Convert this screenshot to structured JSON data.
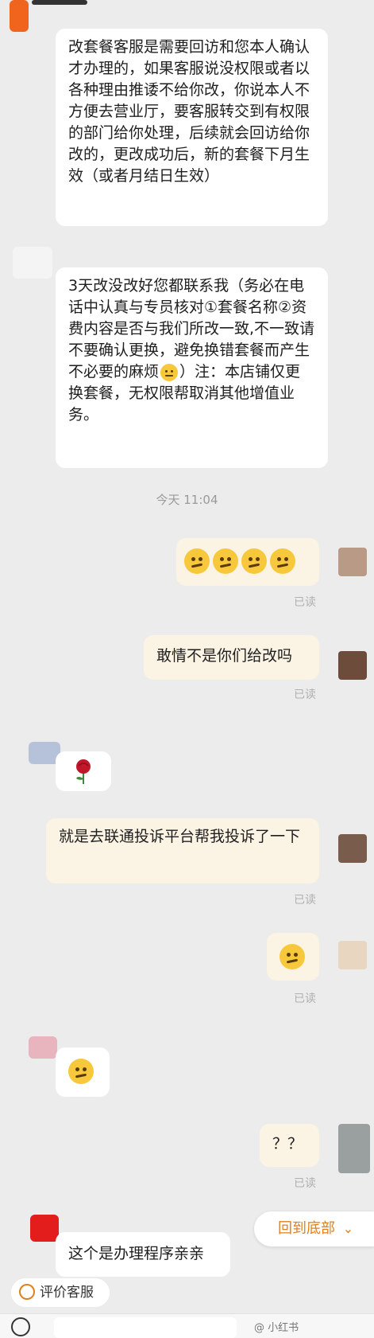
{
  "messages": {
    "m1": {
      "text": "改套餐客服是需要回访和您本人确认才办理的，如果客服说没权限或者以各种理由推诿不给你改，你说本人不方便去营业厅，要客服转交到有权限的部门给你处理，后续就会回访给你改的，更改成功后，新的套餐下月生效（或者月结日生效）"
    },
    "m2": {
      "text_a": "3天改没改好您都联系我（务必在电话中认真与专员核对①套餐名称②资费内容是否与我们所改一致,不一致请不要确认更换，避免换错套餐而产生不必要的麻烦",
      "text_b": "）注：本店铺仅更换套餐，无权限帮取消其他增值业务。"
    },
    "time": "今天  11:04",
    "m3": {
      "emoji_count": 4,
      "read": "已读"
    },
    "m4": {
      "text": "敢情不是你们给改吗",
      "read": "已读"
    },
    "m5": {
      "icon": "rose"
    },
    "m6": {
      "text": "就是去联通投诉平台帮我投诉了一下",
      "read": "已读"
    },
    "m7": {
      "read": "已读"
    },
    "m8": {
      "icon": "blush-smile"
    },
    "m9": {
      "text": "？？",
      "read": "已读"
    },
    "m10": {
      "text": "这个是办理程序亲亲"
    }
  },
  "scroll_bottom": {
    "label": "回到底部"
  },
  "rate_service": {
    "label": "评价客服"
  },
  "watermark": "@ 小红书"
}
